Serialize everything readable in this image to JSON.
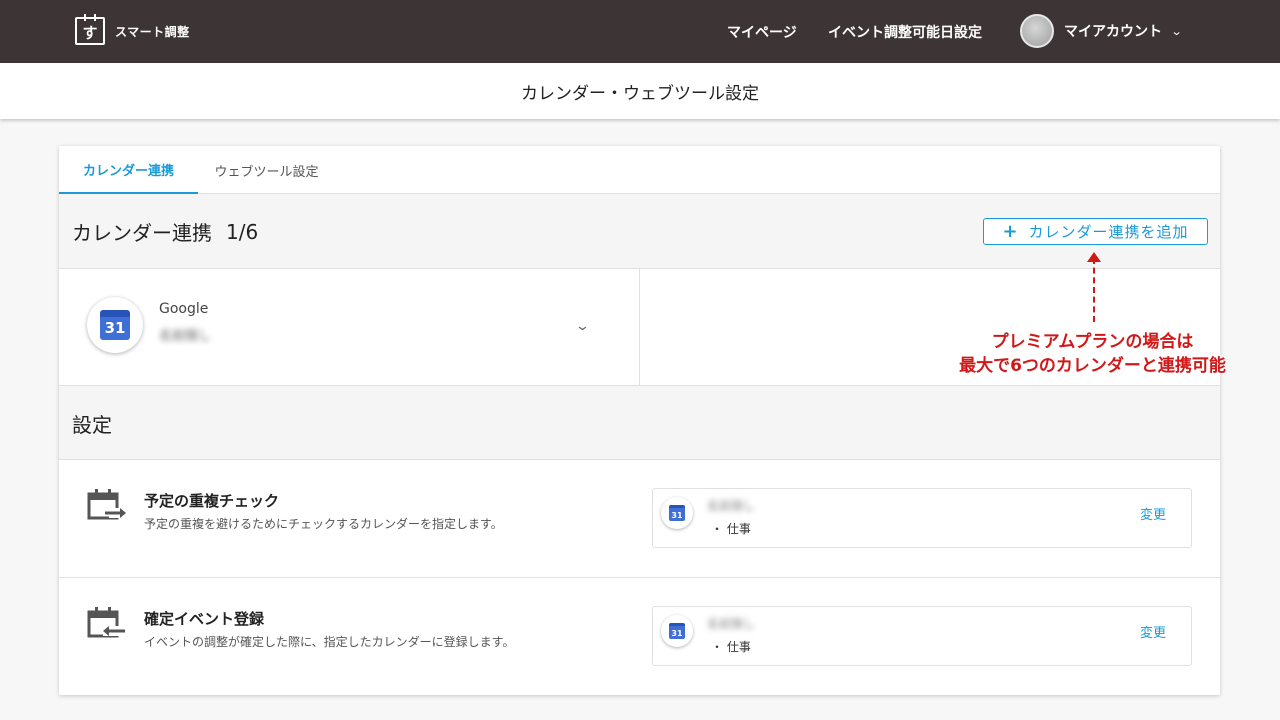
{
  "header": {
    "logo_glyph": "す",
    "logo_text": "スマート調整",
    "nav_mypage": "マイページ",
    "nav_event_settings": "イベント調整可能日設定",
    "account_label": "マイアカウント",
    "account_chevron_icon": "chevron-down-icon"
  },
  "page_title": "カレンダー・ウェブツール設定",
  "tabs": [
    {
      "label": "カレンダー連携",
      "active": true
    },
    {
      "label": "ウェブツール設定",
      "active": false
    }
  ],
  "calendar_section": {
    "title": "カレンダー連携",
    "count": "1/6",
    "add_button_icon": "plus-icon",
    "add_button": "カレンダー連携を追加"
  },
  "linked_calendar": {
    "icon": "google-calendar-icon",
    "icon_number": "31",
    "provider": "Google",
    "account": "名前隠し",
    "expand_icon": "chevron-down-icon"
  },
  "annotation": {
    "line1": "プレミアムプランの場合は",
    "line2": "最大で6つのカレンダーと連携可能",
    "color": "#d01818"
  },
  "settings_section": {
    "title": "設定",
    "rows": [
      {
        "icon": "calendar-export-icon",
        "title": "予定の重複チェック",
        "description": "予定の重複を避けるためにチェックするカレンダーを指定します。",
        "calendar_icon_number": "31",
        "calendar_name": "名前隠し",
        "calendar_sub": "・ 仕事",
        "change_label": "変更"
      },
      {
        "icon": "calendar-import-icon",
        "title": "確定イベント登録",
        "description": "イベントの調整が確定した際に、指定したカレンダーに登録します。",
        "calendar_icon_number": "31",
        "calendar_name": "名前隠し",
        "calendar_sub": "・ 仕事",
        "change_label": "変更"
      }
    ]
  },
  "colors": {
    "header_bg": "#3d3535",
    "accent": "#1a9bd7",
    "google_blue": "#3f6fd6"
  }
}
